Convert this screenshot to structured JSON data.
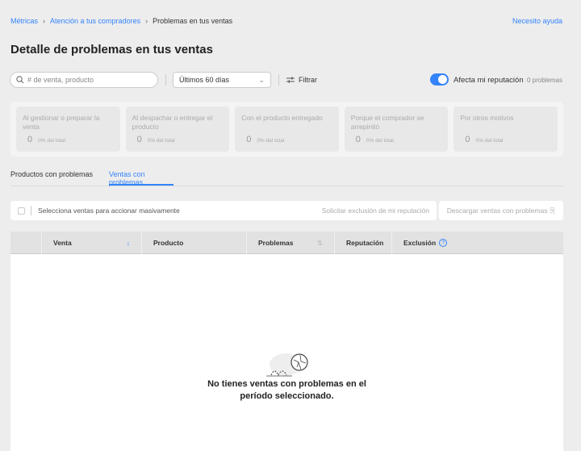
{
  "breadcrumb": [
    "Métricas",
    "Atención a tus compradores",
    "Problemas en tus ventas"
  ],
  "help_link": "Necesito ayuda",
  "title": "Detalle de problemas en tus ventas",
  "filters": {
    "search_placeholder": "# de venta, producto",
    "period": "Últimos 60 días",
    "filter_label": "Filtrar",
    "toggle_label": "Afecta mi reputación",
    "toggle_on": true,
    "problem_count": "0 problemas"
  },
  "cards": [
    {
      "label": "Al gestionar o preparar la venta",
      "value": "0",
      "pct": "0% del total"
    },
    {
      "label": "Al despachar o entregar el producto",
      "value": "0",
      "pct": "0% del total"
    },
    {
      "label": "Con el producto entregado",
      "value": "0",
      "pct": "0% del total"
    },
    {
      "label": "Porque el comprador se arrepintió",
      "value": "0",
      "pct": "0% del total"
    },
    {
      "label": "Por otros motivos",
      "value": "0",
      "pct": "0% del total"
    }
  ],
  "tabs": [
    "Productos con problemas",
    "Ventas con problemas"
  ],
  "bulk": {
    "label": "Selecciona ventas para accionar masivamente",
    "action": "Solicitar exclusión de mi reputación",
    "download": "Descargar ventas con problemas"
  },
  "columns": [
    "Venta",
    "Producto",
    "Problemas",
    "Reputación",
    "Exclusión"
  ],
  "empty": {
    "line1": "No tienes ventas con problemas en el",
    "line2": "período seleccionado."
  },
  "colors": {
    "accent": "#3483fa",
    "background": "#ededed"
  }
}
